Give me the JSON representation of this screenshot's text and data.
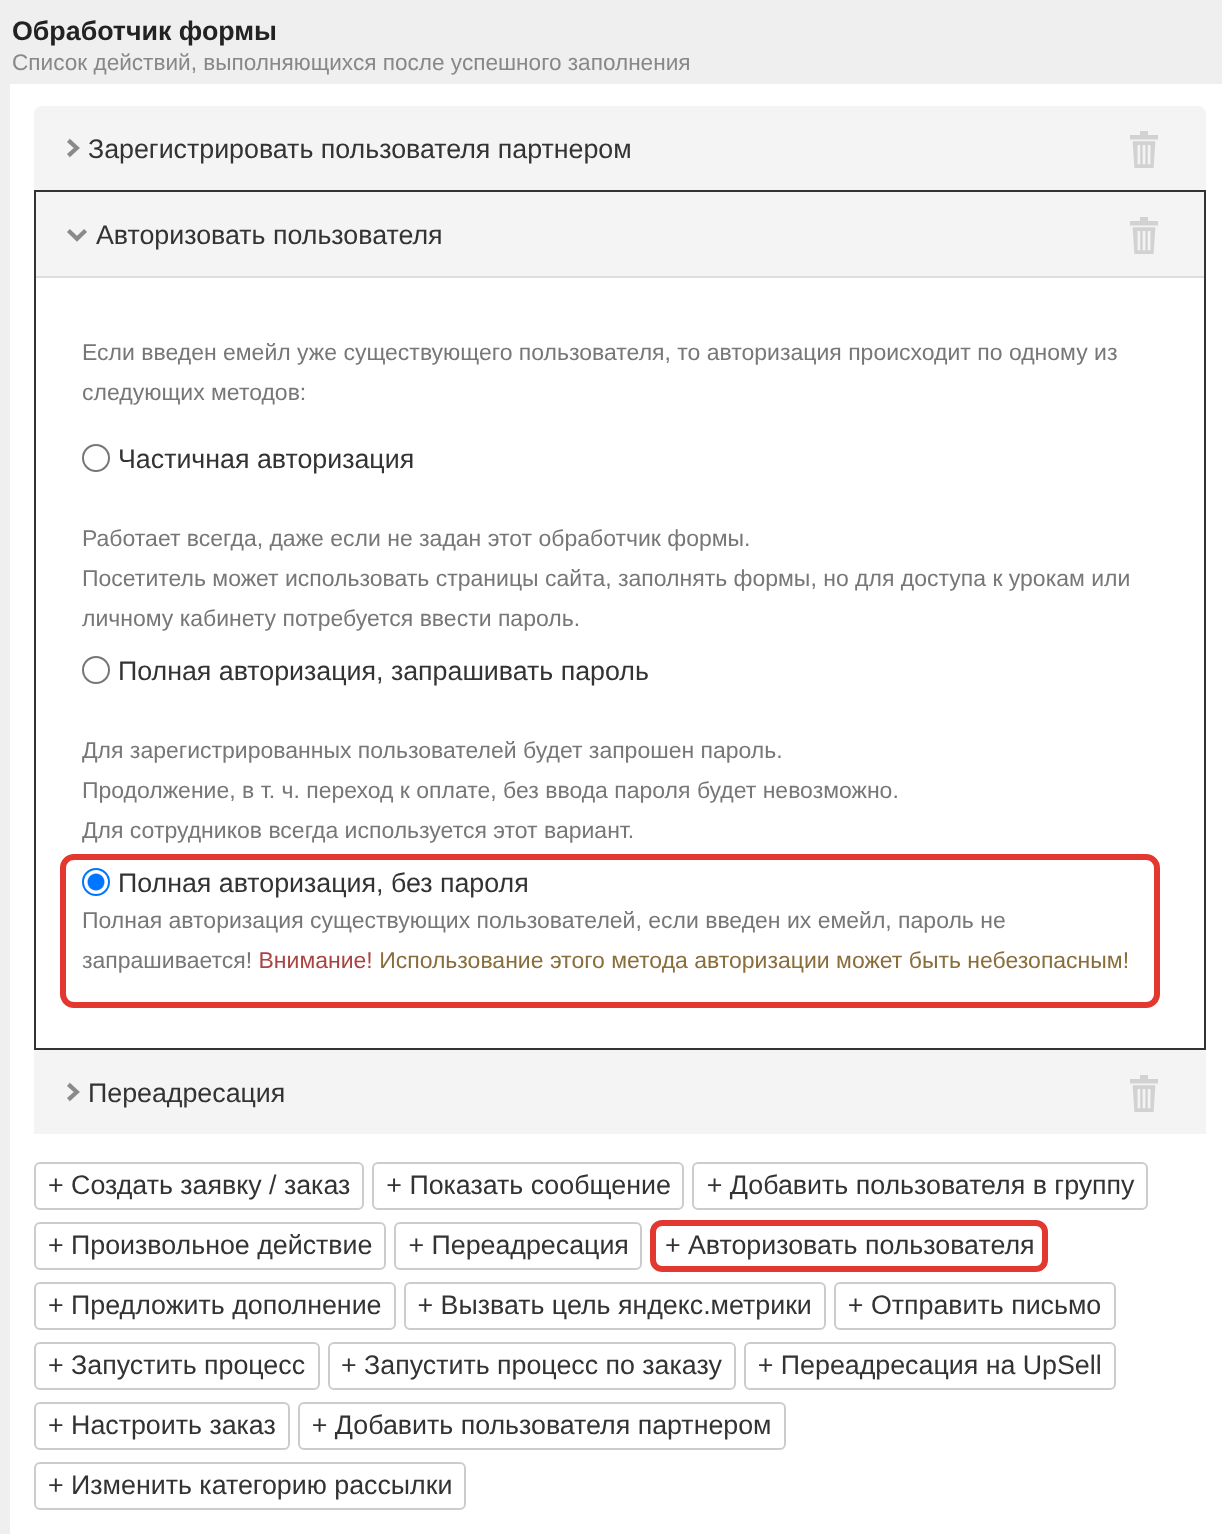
{
  "header": {
    "title": "Обработчик формы",
    "subtitle": "Список действий, выполняющихся после успешного заполнения"
  },
  "actions": [
    {
      "title": "Зарегистрировать пользователя партнером",
      "expanded": false
    },
    {
      "title": "Авторизовать пользователя",
      "expanded": true,
      "intro": "Если введен емейл уже существующего пользователя, то авторизация происходит по одному из следующих методов:",
      "auth_options": [
        {
          "label": "Частичная авторизация",
          "selected": false,
          "highlighted": false,
          "description": [
            "Работает всегда, даже если не задан этот обработчик формы.",
            "Посетитель может использовать страницы сайта, заполнять формы, но для доступа к урокам или личному кабинету потребуется ввести пароль."
          ]
        },
        {
          "label": "Полная авторизация, запрашивать пароль",
          "selected": false,
          "highlighted": false,
          "description": [
            "Для зарегистрированных пользователей будет запрошен пароль.",
            "Продолжение, в т. ч. переход к оплате, без ввода пароля будет невозможно.",
            "Для сотрудников всегда используется этот вариант."
          ]
        },
        {
          "label": "Полная авторизация, без пароля",
          "selected": true,
          "highlighted": true,
          "description": [
            "Полная авторизация существующих пользователей, если введен их емейл, пароль не запрашивается!"
          ],
          "warning": {
            "label": "Внимание!",
            "text": "Использование этого метода авторизации может быть небезопасным!"
          }
        }
      ]
    },
    {
      "title": "Переадресация",
      "expanded": false
    }
  ],
  "add_buttons": [
    {
      "label": "+ Создать заявку / заказ",
      "highlighted": false
    },
    {
      "label": "+ Показать сообщение",
      "highlighted": false
    },
    {
      "label": "+ Добавить пользователя в группу",
      "highlighted": false
    },
    {
      "label": "+ Произвольное действие",
      "highlighted": false
    },
    {
      "label": "+ Переадресация",
      "highlighted": false
    },
    {
      "label": "+ Авторизовать пользователя",
      "highlighted": true
    },
    {
      "label": "+ Предложить дополнение",
      "highlighted": false
    },
    {
      "label": "+ Вызвать цель яндекс.метрики",
      "highlighted": false
    },
    {
      "label": "+ Отправить письмо",
      "highlighted": false
    },
    {
      "label": "+ Запустить процесс",
      "highlighted": false
    },
    {
      "label": "+ Запустить процесс по заказу",
      "highlighted": false
    },
    {
      "label": "+ Переадресация на UpSell",
      "highlighted": false
    },
    {
      "label": "+ Настроить заказ",
      "highlighted": false
    },
    {
      "label": "+ Добавить пользователя партнером",
      "highlighted": false
    },
    {
      "label": "+ Изменить категорию рассылки",
      "highlighted": false
    }
  ]
}
